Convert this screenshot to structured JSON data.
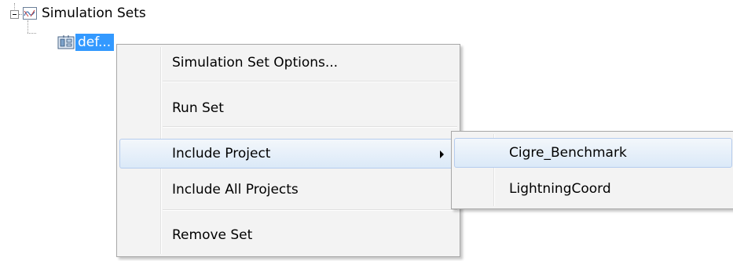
{
  "tree": {
    "root": {
      "label": "Simulation Sets",
      "icon": "simulation-sets-icon"
    },
    "child": {
      "label": "def...",
      "icon": "simulation-set-icon",
      "selected": true
    }
  },
  "context_menu": {
    "items": [
      {
        "label": "Simulation Set Options..."
      },
      {
        "label": "Run Set"
      },
      {
        "label": "Include Project",
        "has_submenu": true,
        "highlighted": true
      },
      {
        "label": "Include All Projects"
      },
      {
        "label": "Remove Set"
      }
    ]
  },
  "submenu": {
    "items": [
      {
        "label": "Cigre_Benchmark",
        "highlighted": true
      },
      {
        "label": "LightningCoord"
      }
    ]
  },
  "colors": {
    "selection": "#3399ff",
    "menu_background": "#f3f3f3",
    "highlight_border": "#b5ccee"
  }
}
